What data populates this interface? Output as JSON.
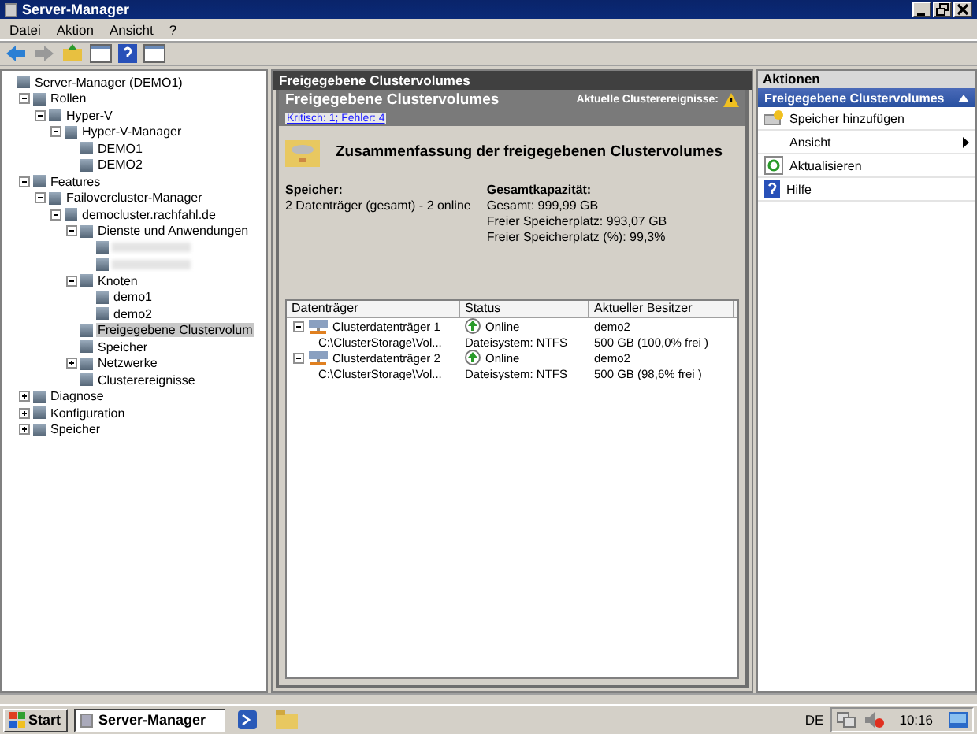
{
  "window": {
    "title": "Server-Manager"
  },
  "menu": [
    "Datei",
    "Aktion",
    "Ansicht",
    "?"
  ],
  "tree": [
    {
      "label": "Server-Manager (DEMO1)",
      "selected": false,
      "children": [
        {
          "label": "Rollen",
          "expanded": true,
          "selected": false,
          "children": [
            {
              "label": "Hyper-V",
              "expanded": true,
              "selected": false,
              "children": [
                {
                  "label": "Hyper-V-Manager",
                  "expanded": true,
                  "selected": false,
                  "children": [
                    {
                      "label": "DEMO1",
                      "selected": false
                    },
                    {
                      "label": "DEMO2",
                      "selected": false
                    }
                  ]
                }
              ]
            }
          ]
        },
        {
          "label": "Features",
          "expanded": true,
          "selected": false,
          "children": [
            {
              "label": "Failovercluster-Manager",
              "expanded": true,
              "selected": false,
              "children": [
                {
                  "label": "democluster.rachfahl.de",
                  "expanded": true,
                  "selected": false,
                  "children": [
                    {
                      "label": "Dienste und Anwendungen",
                      "expanded": true,
                      "selected": false,
                      "children": [
                        {
                          "kind": "redacted"
                        },
                        {
                          "kind": "redacted"
                        }
                      ]
                    },
                    {
                      "label": "Knoten",
                      "expanded": true,
                      "selected": false,
                      "children": [
                        {
                          "label": "demo1",
                          "selected": false
                        },
                        {
                          "label": "demo2",
                          "selected": false
                        }
                      ]
                    },
                    {
                      "label": "Freigegebene Clustervolum",
                      "selected": true
                    },
                    {
                      "label": "Speicher",
                      "selected": false
                    },
                    {
                      "label": "Netzwerke",
                      "expanded": false,
                      "selected": false
                    },
                    {
                      "label": "Clusterereignisse",
                      "selected": false
                    }
                  ]
                }
              ]
            }
          ]
        },
        {
          "label": "Diagnose",
          "expanded": false,
          "selected": false
        },
        {
          "label": "Konfiguration",
          "expanded": false,
          "selected": false
        },
        {
          "label": "Speicher",
          "expanded": false,
          "selected": false
        }
      ]
    }
  ],
  "content": {
    "pane_title": "Freigegebene Clustervolumes",
    "header_title": "Freigegebene Clustervolumes",
    "events_label": "Aktuelle Clusterereignisse:",
    "events_link": "Kritisch: 1; Fehler: 4",
    "summary_title": "Zusammenfassung der freigegebenen Clustervolumes",
    "storage": {
      "heading": "Speicher:",
      "lines": [
        "2 Datenträger (gesamt) - 2 online"
      ]
    },
    "capacity": {
      "heading": "Gesamtkapazität:",
      "lines": [
        "Gesamt: 999,99 GB",
        "Freier Speicherplatz: 993,07 GB",
        "Freier Speicherplatz (%): 99,3%"
      ]
    },
    "table": {
      "columns": [
        "Datenträger",
        "Status",
        "Aktueller Besitzer"
      ],
      "rows": [
        {
          "name": "Clusterdatenträger 1",
          "status": "Online",
          "owner": "demo2",
          "expanded": true,
          "path": "C:\\ClusterStorage\\Vol...",
          "filesystem": "Dateisystem: NTFS",
          "space": "500 GB (100,0% frei )"
        },
        {
          "name": "Clusterdatenträger 2",
          "status": "Online",
          "owner": "demo2",
          "expanded": true,
          "path": "C:\\ClusterStorage\\Vol...",
          "filesystem": "Dateisystem: NTFS",
          "space": "500 GB (98,6% frei )"
        }
      ]
    }
  },
  "actions": {
    "title": "Aktionen",
    "section": "Freigegebene Clustervolumes",
    "expanded": true,
    "items": [
      {
        "kind": "action",
        "label": "Speicher hinzufügen"
      },
      {
        "kind": "submenu",
        "label": "Ansicht"
      },
      {
        "kind": "refresh",
        "label": "Aktualisieren"
      },
      {
        "kind": "help",
        "label": "Hilfe"
      }
    ]
  },
  "taskbar": {
    "start": "Start",
    "apps": [
      {
        "label": "Server-Manager",
        "selected": true
      }
    ],
    "language": "DE",
    "clock": "10:16"
  }
}
